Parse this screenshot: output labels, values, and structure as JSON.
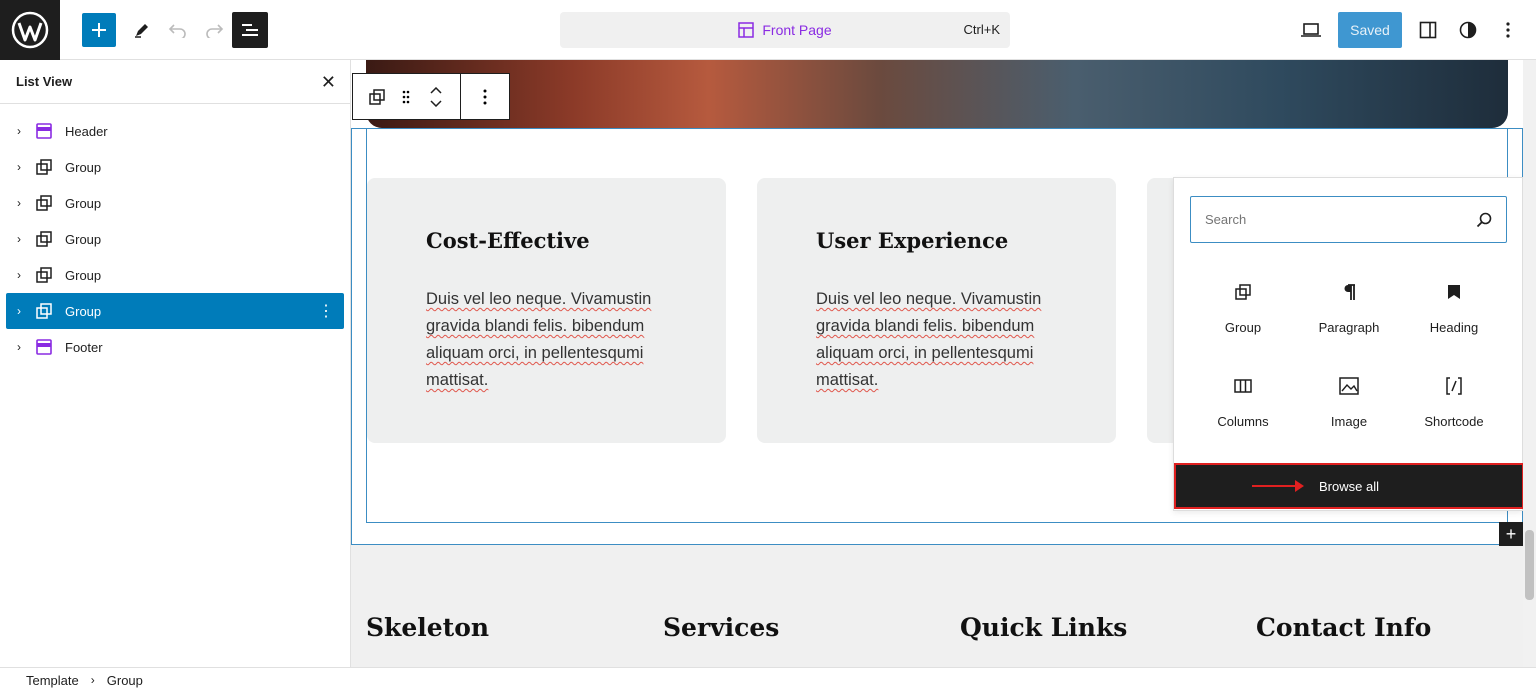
{
  "topbar": {
    "doc_title": "Front Page",
    "shortcut": "Ctrl+K",
    "saved_label": "Saved"
  },
  "sidebar": {
    "title": "List View",
    "items": [
      {
        "label": "Header",
        "icon": "template-part-icon",
        "selected": false
      },
      {
        "label": "Group",
        "icon": "group-icon",
        "selected": false
      },
      {
        "label": "Group",
        "icon": "group-icon",
        "selected": false
      },
      {
        "label": "Group",
        "icon": "group-icon",
        "selected": false
      },
      {
        "label": "Group",
        "icon": "group-icon",
        "selected": false
      },
      {
        "label": "Group",
        "icon": "group-icon",
        "selected": true
      },
      {
        "label": "Footer",
        "icon": "template-part-icon",
        "selected": false
      }
    ]
  },
  "cards": [
    {
      "title": "Cost-Effective",
      "body": "Duis vel leo neque. Vivamustin gravida blandi felis. bibendum aliquam orci, in pellentesqumi mattisat."
    },
    {
      "title": "User Experience",
      "body": "Duis vel leo neque. Vivamustin gravida blandi felis. bibendum aliquam orci, in pellentesqumi mattisat."
    }
  ],
  "inserter": {
    "search_placeholder": "Search",
    "blocks": [
      {
        "label": "Group",
        "icon": "group-icon"
      },
      {
        "label": "Paragraph",
        "icon": "paragraph-icon"
      },
      {
        "label": "Heading",
        "icon": "heading-icon"
      },
      {
        "label": "Columns",
        "icon": "columns-icon"
      },
      {
        "label": "Image",
        "icon": "image-icon"
      },
      {
        "label": "Shortcode",
        "icon": "shortcode-icon"
      }
    ],
    "browse_all_label": "Browse all"
  },
  "footer_headings": [
    "Skeleton",
    "Services",
    "Quick Links",
    "Contact Info"
  ],
  "breadcrumb": [
    "Template",
    "Group"
  ],
  "colors": {
    "accent": "#007cba",
    "doc_title": "#8a2be2",
    "highlight": "#e02020"
  }
}
